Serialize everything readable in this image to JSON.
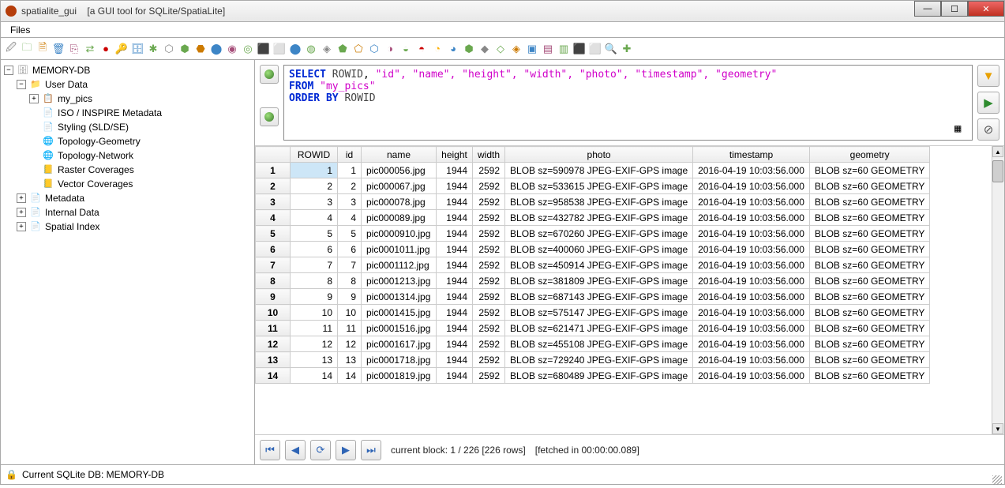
{
  "window": {
    "app_name": "spatialite_gui",
    "subtitle": "[a GUI tool for SQLite/SpatiaLite]"
  },
  "menu": {
    "files": "Files"
  },
  "tree": {
    "root": "MEMORY-DB",
    "user_data": "User Data",
    "items": [
      "my_pics",
      "ISO / INSPIRE Metadata",
      "Styling (SLD/SE)",
      "Topology-Geometry",
      "Topology-Network",
      "Raster Coverages",
      "Vector Coverages"
    ],
    "metadata": "Metadata",
    "internal": "Internal Data",
    "spatial": "Spatial Index"
  },
  "sql": {
    "select": "SELECT",
    "rowid": "ROWID",
    "cols": "\"id\", \"name\", \"height\", \"width\", \"photo\", \"timestamp\", \"geometry\"",
    "from": "FROM",
    "table": "\"my_pics\"",
    "orderby": "ORDER BY",
    "orderby_col": "ROWID"
  },
  "grid": {
    "headers": [
      "ROWID",
      "id",
      "name",
      "height",
      "width",
      "photo",
      "timestamp",
      "geometry"
    ],
    "rows": [
      {
        "n": "1",
        "rowid": "1",
        "id": "1",
        "name": "pic000056.jpg",
        "h": "1944",
        "w": "2592",
        "photo": "BLOB sz=590978 JPEG-EXIF-GPS image",
        "ts": "2016-04-19 10:03:56.000",
        "geom": "BLOB sz=60 GEOMETRY"
      },
      {
        "n": "2",
        "rowid": "2",
        "id": "2",
        "name": "pic000067.jpg",
        "h": "1944",
        "w": "2592",
        "photo": "BLOB sz=533615 JPEG-EXIF-GPS image",
        "ts": "2016-04-19 10:03:56.000",
        "geom": "BLOB sz=60 GEOMETRY"
      },
      {
        "n": "3",
        "rowid": "3",
        "id": "3",
        "name": "pic000078.jpg",
        "h": "1944",
        "w": "2592",
        "photo": "BLOB sz=958538 JPEG-EXIF-GPS image",
        "ts": "2016-04-19 10:03:56.000",
        "geom": "BLOB sz=60 GEOMETRY"
      },
      {
        "n": "4",
        "rowid": "4",
        "id": "4",
        "name": "pic000089.jpg",
        "h": "1944",
        "w": "2592",
        "photo": "BLOB sz=432782 JPEG-EXIF-GPS image",
        "ts": "2016-04-19 10:03:56.000",
        "geom": "BLOB sz=60 GEOMETRY"
      },
      {
        "n": "5",
        "rowid": "5",
        "id": "5",
        "name": "pic0000910.jpg",
        "h": "1944",
        "w": "2592",
        "photo": "BLOB sz=670260 JPEG-EXIF-GPS image",
        "ts": "2016-04-19 10:03:56.000",
        "geom": "BLOB sz=60 GEOMETRY"
      },
      {
        "n": "6",
        "rowid": "6",
        "id": "6",
        "name": "pic0001011.jpg",
        "h": "1944",
        "w": "2592",
        "photo": "BLOB sz=400060 JPEG-EXIF-GPS image",
        "ts": "2016-04-19 10:03:56.000",
        "geom": "BLOB sz=60 GEOMETRY"
      },
      {
        "n": "7",
        "rowid": "7",
        "id": "7",
        "name": "pic0001112.jpg",
        "h": "1944",
        "w": "2592",
        "photo": "BLOB sz=450914 JPEG-EXIF-GPS image",
        "ts": "2016-04-19 10:03:56.000",
        "geom": "BLOB sz=60 GEOMETRY"
      },
      {
        "n": "8",
        "rowid": "8",
        "id": "8",
        "name": "pic0001213.jpg",
        "h": "1944",
        "w": "2592",
        "photo": "BLOB sz=381809 JPEG-EXIF-GPS image",
        "ts": "2016-04-19 10:03:56.000",
        "geom": "BLOB sz=60 GEOMETRY"
      },
      {
        "n": "9",
        "rowid": "9",
        "id": "9",
        "name": "pic0001314.jpg",
        "h": "1944",
        "w": "2592",
        "photo": "BLOB sz=687143 JPEG-EXIF-GPS image",
        "ts": "2016-04-19 10:03:56.000",
        "geom": "BLOB sz=60 GEOMETRY"
      },
      {
        "n": "10",
        "rowid": "10",
        "id": "10",
        "name": "pic0001415.jpg",
        "h": "1944",
        "w": "2592",
        "photo": "BLOB sz=575147 JPEG-EXIF-GPS image",
        "ts": "2016-04-19 10:03:56.000",
        "geom": "BLOB sz=60 GEOMETRY"
      },
      {
        "n": "11",
        "rowid": "11",
        "id": "11",
        "name": "pic0001516.jpg",
        "h": "1944",
        "w": "2592",
        "photo": "BLOB sz=621471 JPEG-EXIF-GPS image",
        "ts": "2016-04-19 10:03:56.000",
        "geom": "BLOB sz=60 GEOMETRY"
      },
      {
        "n": "12",
        "rowid": "12",
        "id": "12",
        "name": "pic0001617.jpg",
        "h": "1944",
        "w": "2592",
        "photo": "BLOB sz=455108 JPEG-EXIF-GPS image",
        "ts": "2016-04-19 10:03:56.000",
        "geom": "BLOB sz=60 GEOMETRY"
      },
      {
        "n": "13",
        "rowid": "13",
        "id": "13",
        "name": "pic0001718.jpg",
        "h": "1944",
        "w": "2592",
        "photo": "BLOB sz=729240 JPEG-EXIF-GPS image",
        "ts": "2016-04-19 10:03:56.000",
        "geom": "BLOB sz=60 GEOMETRY"
      },
      {
        "n": "14",
        "rowid": "14",
        "id": "14",
        "name": "pic0001819.jpg",
        "h": "1944",
        "w": "2592",
        "photo": "BLOB sz=680489 JPEG-EXIF-GPS image",
        "ts": "2016-04-19 10:03:56.000",
        "geom": "BLOB sz=60 GEOMETRY"
      }
    ]
  },
  "pager": {
    "block_text": "current block: 1 / 226 [226 rows]",
    "fetch_text": "[fetched in 00:00:00.089]"
  },
  "status": {
    "text": "Current SQLite DB: MEMORY-DB"
  },
  "toolbar_icons": [
    "🖉",
    "🗀",
    "🗎",
    "🗑",
    "⎘",
    "⇄",
    "●",
    "🔑",
    "🗄",
    "✱",
    "⬡",
    "⬢",
    "⬣",
    "⬤",
    "◉",
    "◎",
    "⬛",
    "⬜",
    "⬤",
    "◍",
    "◈",
    "⬟",
    "⬠",
    "⬡",
    "◑",
    "◒",
    "◓",
    "◔",
    "◕",
    "⬢",
    "◆",
    "◇",
    "◈",
    "▣",
    "▤",
    "▥",
    "⬛",
    "⬜",
    "🔍",
    "✚"
  ]
}
